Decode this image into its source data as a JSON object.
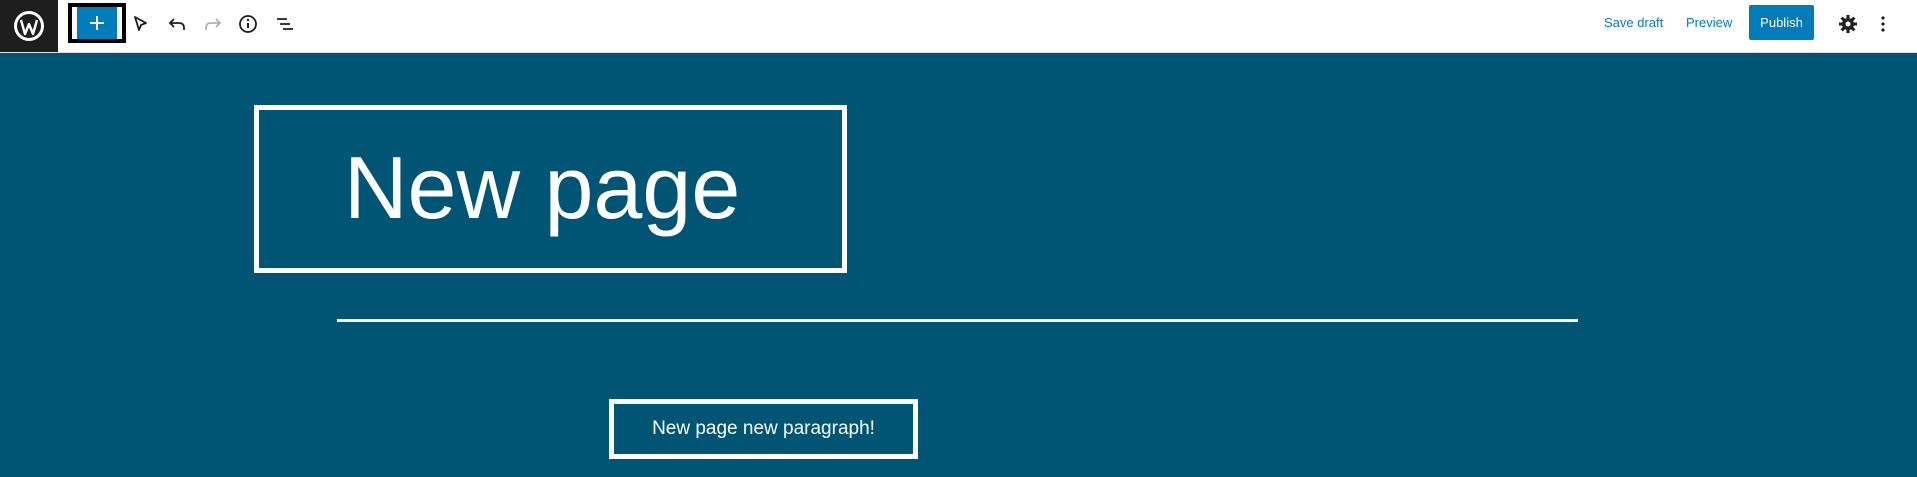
{
  "toolbar": {
    "logo_icon": "wordpress-logo-icon",
    "inserter_icon": "plus-icon",
    "tools": [
      "select-tool-icon",
      "undo-icon",
      "redo-icon",
      "info-icon",
      "list-view-icon"
    ],
    "save_draft_label": "Save draft",
    "preview_label": "Preview",
    "publish_label": "Publish",
    "settings_icon": "gear-icon",
    "options_icon": "kebab-menu-icon"
  },
  "editor": {
    "title": "New page",
    "paragraph": "New page new paragraph!"
  },
  "colors": {
    "background": "#005575",
    "accent": "#007cba",
    "logo_bg": "#1e1e1e"
  }
}
